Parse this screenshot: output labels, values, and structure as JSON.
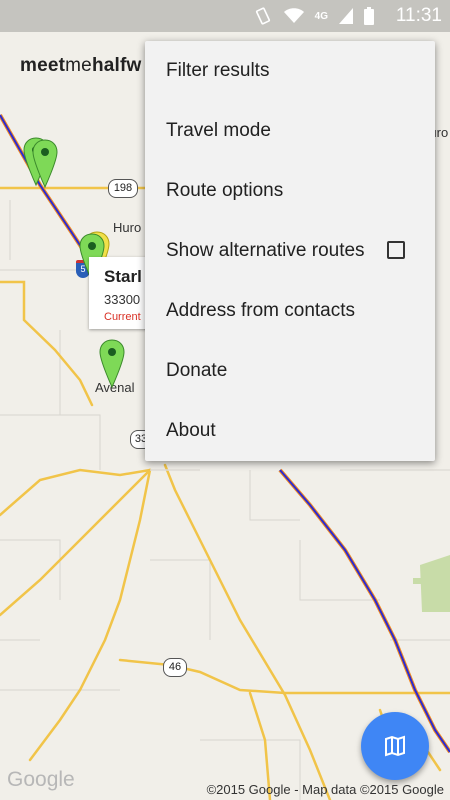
{
  "status_bar": {
    "time": "11:31",
    "network": "4G",
    "icons": [
      "vibrate-icon",
      "wifi-icon",
      "signal-icon",
      "battery-icon"
    ]
  },
  "app": {
    "title_bold": "meet",
    "title_light": "me",
    "title_rest": "halfw"
  },
  "map": {
    "places": [
      "Huro",
      "Avenal"
    ],
    "routes": [
      "198",
      "33",
      "46",
      "5"
    ],
    "top_right_label": "Huro"
  },
  "infobox": {
    "title": "Starl",
    "address": "33300",
    "current": "Current"
  },
  "menu": {
    "items": [
      {
        "label": "Filter results"
      },
      {
        "label": "Travel mode"
      },
      {
        "label": "Route options"
      },
      {
        "label": "Show alternative routes",
        "checked": false
      },
      {
        "label": "Address from contacts"
      },
      {
        "label": "Donate"
      },
      {
        "label": "About"
      }
    ]
  },
  "footer": {
    "logo": "Google",
    "attribution": "©2015 Google - Map data ©2015 Google"
  },
  "colors": {
    "fab": "#3f86f5",
    "route_blue": "#2b2bd1",
    "route_orange": "#f08a24",
    "highway": "#f4c542",
    "marker": "#7ed957"
  }
}
